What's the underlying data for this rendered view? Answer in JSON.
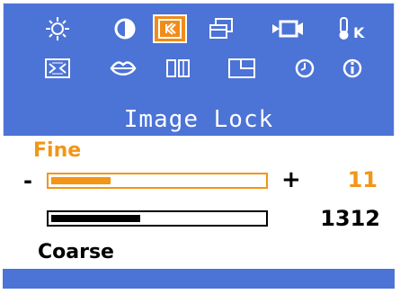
{
  "menu": {
    "title": "Image Lock",
    "selected_icon": "image-lock-icon",
    "icons_row1": [
      "brightness-icon",
      "contrast-icon",
      "image-lock-icon",
      "position-icon",
      "video-icon",
      "color-temperature-icon"
    ],
    "icons_row2": [
      "image-size-icon",
      "sharpness-icon",
      "split-screen-icon",
      "pip-icon",
      "clock-icon",
      "information-icon"
    ]
  },
  "fine": {
    "label": "Fine",
    "minus": "-",
    "plus": "+",
    "value": "11",
    "level": 0.28
  },
  "coarse": {
    "label": "Coarse",
    "value": "1312",
    "level": 0.42
  },
  "colors": {
    "background": "#4c73d6",
    "accent": "#f39516",
    "text": "#000000"
  }
}
